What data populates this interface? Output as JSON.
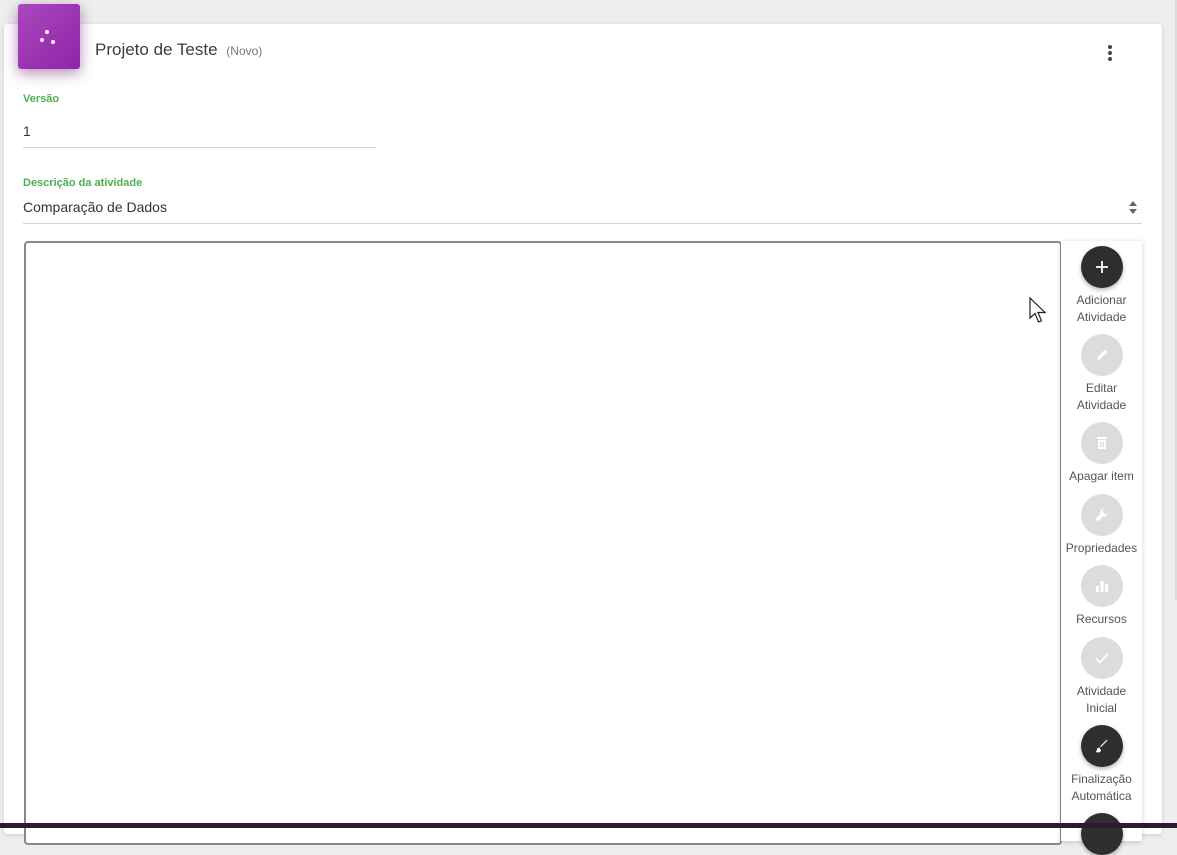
{
  "header": {
    "title": "Projeto de Teste",
    "status": "(Novo)",
    "app_icon": "scatter-dots-icon",
    "menu_icon": "more-vert-icon"
  },
  "form": {
    "version_label": "Versão",
    "version_value": "1",
    "description_label": "Descrição da atividade",
    "description_value": "Comparação de Dados"
  },
  "toolbar": {
    "items": [
      {
        "label1": "Adicionar",
        "label2": "Atividade",
        "icon": "plus-icon",
        "enabled": true
      },
      {
        "label1": "Editar",
        "label2": "Atividade",
        "icon": "pencil-icon",
        "enabled": false
      },
      {
        "label1": "Apagar item",
        "label2": "",
        "icon": "trash-icon",
        "enabled": false
      },
      {
        "label1": "Propriedades",
        "label2": "",
        "icon": "wrench-icon",
        "enabled": false
      },
      {
        "label1": "Recursos",
        "label2": "",
        "icon": "bar-chart-icon",
        "enabled": false
      },
      {
        "label1": "Atividade",
        "label2": "Inicial",
        "icon": "check-icon",
        "enabled": false
      },
      {
        "label1": "Finalização",
        "label2": "Automática",
        "icon": "brush-icon",
        "enabled": true
      }
    ]
  },
  "colors": {
    "brand": "#9c27b0",
    "label_green": "#4caf50",
    "dark_button": "#2e2e2e",
    "disabled_button": "#dcdcdc"
  }
}
